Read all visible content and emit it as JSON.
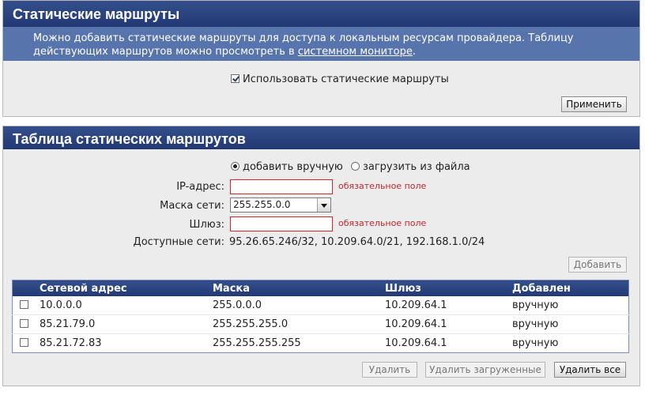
{
  "section1": {
    "title": "Статические маршруты",
    "info_text_before": "Можно добавить статические маршруты для доступа к локальным ресурсам провайдера. Таблицу действующих маршрутов можно просмотреть в ",
    "info_link": "системном мониторе",
    "info_text_after": ".",
    "use_static_label": "Использовать статические маршруты",
    "use_static_checked": true,
    "apply_label": "Применить"
  },
  "section2": {
    "title": "Таблица статических маршрутов",
    "radio_manual": "добавить вручную",
    "radio_file": "загрузить из файла",
    "ip_label": "IP-адрес:",
    "ip_value": "",
    "mask_label": "Маска сети:",
    "mask_value": "255.255.0.0",
    "gateway_label": "Шлюз:",
    "gateway_value": "",
    "required_text": "обязательное поле",
    "networks_label": "Доступные сети:",
    "networks_value": "95.26.65.246/32, 10.209.64.0/21, 192.168.1.0/24",
    "add_label": "Добавить",
    "table": {
      "headers": [
        "Сетевой адрес",
        "Маска",
        "Шлюз",
        "Добавлен"
      ],
      "rows": [
        [
          "10.0.0.0",
          "255.0.0.0",
          "10.209.64.1",
          "вручную"
        ],
        [
          "85.21.79.0",
          "255.255.255.0",
          "10.209.64.1",
          "вручную"
        ],
        [
          "85.21.72.83",
          "255.255.255.255",
          "10.209.64.1",
          "вручную"
        ]
      ]
    },
    "delete_label": "Удалить",
    "delete_loaded_label": "Удалить загруженные",
    "delete_all_label": "Удалить все"
  }
}
